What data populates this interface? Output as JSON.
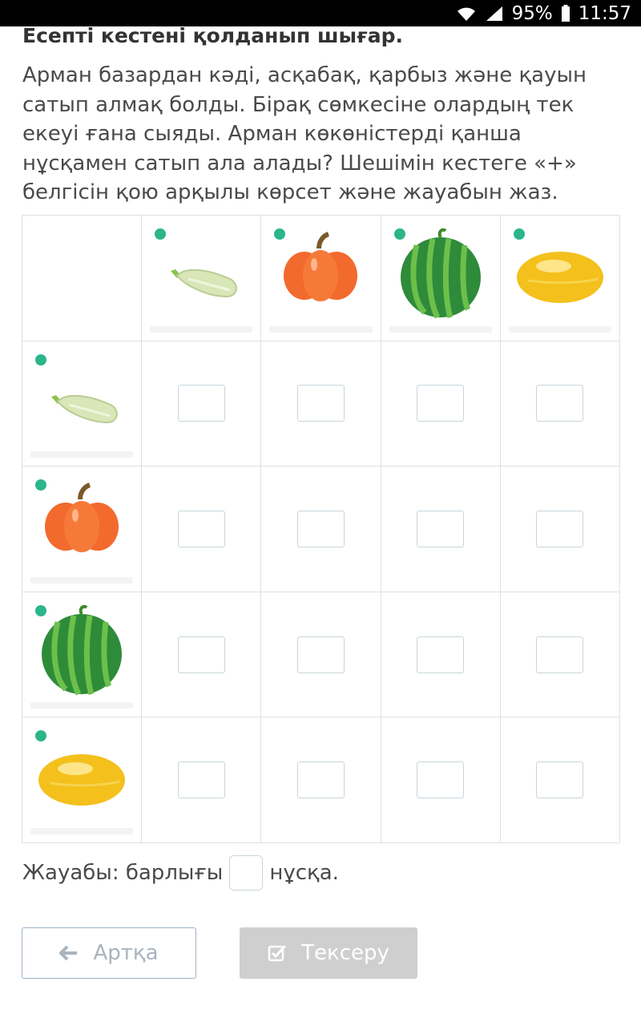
{
  "status_bar": {
    "battery": "95%",
    "time": "11:57"
  },
  "title": "Есепті кестені қолданып шығар.",
  "task_text": "Арман базардан кәді, асқабақ, қарбыз және қауын сатып алмақ болды. Бірақ сөмкесіне олардың тек екеуі ғана сыяды. Арман көкөністерді қанша нұсқамен сатып ала алады? Шешімін кестеге «+» белгісін қою арқылы көрсет және жауабын жаз.",
  "items": [
    "zucchini",
    "pumpkin",
    "watermelon",
    "melon"
  ],
  "colors": {
    "zucchini": "#d8e6b8",
    "pumpkin": "#f26a2e",
    "watermelon": "#2e8b3a",
    "melon": "#f4c01c",
    "logo": "#2bb58a"
  },
  "answer": {
    "prefix": "Жауабы: барлығы",
    "suffix": "нұсқа."
  },
  "buttons": {
    "back": "Артқа",
    "check": "Тексеру"
  },
  "icons": [
    "wifi-icon",
    "signal-icon",
    "battery-icon",
    "arrow-left-icon",
    "checkbox-icon"
  ]
}
